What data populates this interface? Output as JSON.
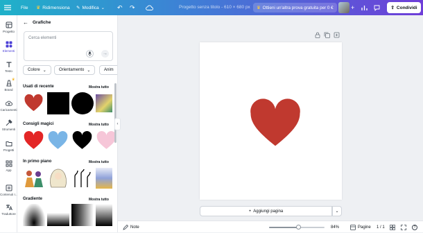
{
  "topbar": {
    "file_label": "File",
    "resize_label": "Ridimensiona",
    "edit_label": "Modifica",
    "doc_title": "Progetto senza titolo - 610 × 680 px",
    "trial_label": "Ottieni un'altra prova gratuita per 0 €",
    "share_label": "Condividi"
  },
  "rail": [
    {
      "label": "Progetto",
      "icon": "layout-icon"
    },
    {
      "label": "Elementi",
      "icon": "shapes-icon",
      "active": true
    },
    {
      "label": "Testo",
      "icon": "text-icon"
    },
    {
      "label": "Brand",
      "icon": "brand-icon"
    },
    {
      "label": "Caricamenti",
      "icon": "upload-icon"
    },
    {
      "label": "Strumenti",
      "icon": "tools-icon"
    },
    {
      "label": "Progetti",
      "icon": "folder-icon"
    },
    {
      "label": "App",
      "icon": "apps-icon"
    },
    {
      "label": "Contenuti I…",
      "icon": "content-icon"
    },
    {
      "label": "Traduttore",
      "icon": "translate-icon"
    }
  ],
  "panel": {
    "title": "Grafiche",
    "search_placeholder": "Cerca elementi",
    "filters": [
      "Colore",
      "Orientamento",
      "Anim"
    ],
    "sections": [
      {
        "title": "Usati di recente",
        "more": "Mostra tutto"
      },
      {
        "title": "Consigli magici",
        "more": "Mostra tutto"
      },
      {
        "title": "In primo piano",
        "more": "Mostra tutto"
      },
      {
        "title": "Gradiente",
        "more": "Mostra tutto"
      }
    ]
  },
  "canvas": {
    "heart_color": "#c0392f",
    "add_page_label": "Aggiungi pagina"
  },
  "bottombar": {
    "notes_label": "Note",
    "zoom": "84%",
    "zoom_fraction": 0.84,
    "pages_label": "Pagine",
    "page_counter": "1 / 1"
  }
}
